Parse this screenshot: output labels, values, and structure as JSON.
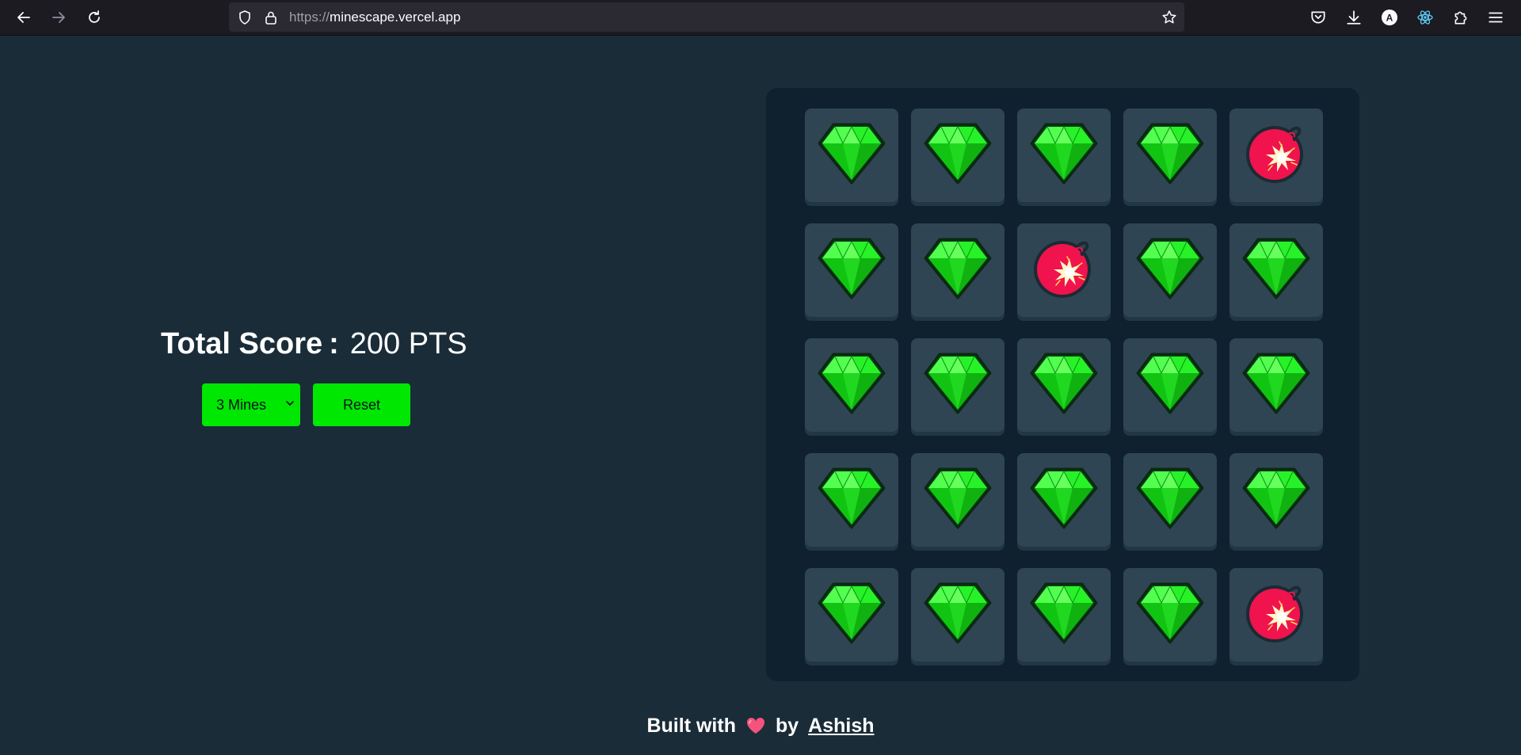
{
  "browser": {
    "url_scheme": "https://",
    "url_host": "minescape.vercel.app",
    "profile_letter": "A"
  },
  "game": {
    "score_label": "Total Score",
    "score_separator": ":",
    "score_value": "200 PTS",
    "mines_select": {
      "selected": "3 Mines"
    },
    "reset_label": "Reset",
    "tiles": [
      [
        "gem",
        "gem",
        "gem",
        "gem",
        "mine"
      ],
      [
        "gem",
        "gem",
        "mine",
        "gem",
        "gem"
      ],
      [
        "gem",
        "gem",
        "gem",
        "gem",
        "gem"
      ],
      [
        "gem",
        "gem",
        "gem",
        "gem",
        "gem"
      ],
      [
        "gem",
        "gem",
        "gem",
        "gem",
        "mine"
      ]
    ]
  },
  "footer": {
    "built_with": "Built with",
    "by": "by",
    "author": "Ashish"
  },
  "colors": {
    "page_bg": "#1a2c38",
    "board_bg": "#0f212e",
    "tile_bg": "#2f4553",
    "accent_green": "#00e701",
    "gem_green": "#1be41b",
    "mine_red": "#f0134d"
  }
}
